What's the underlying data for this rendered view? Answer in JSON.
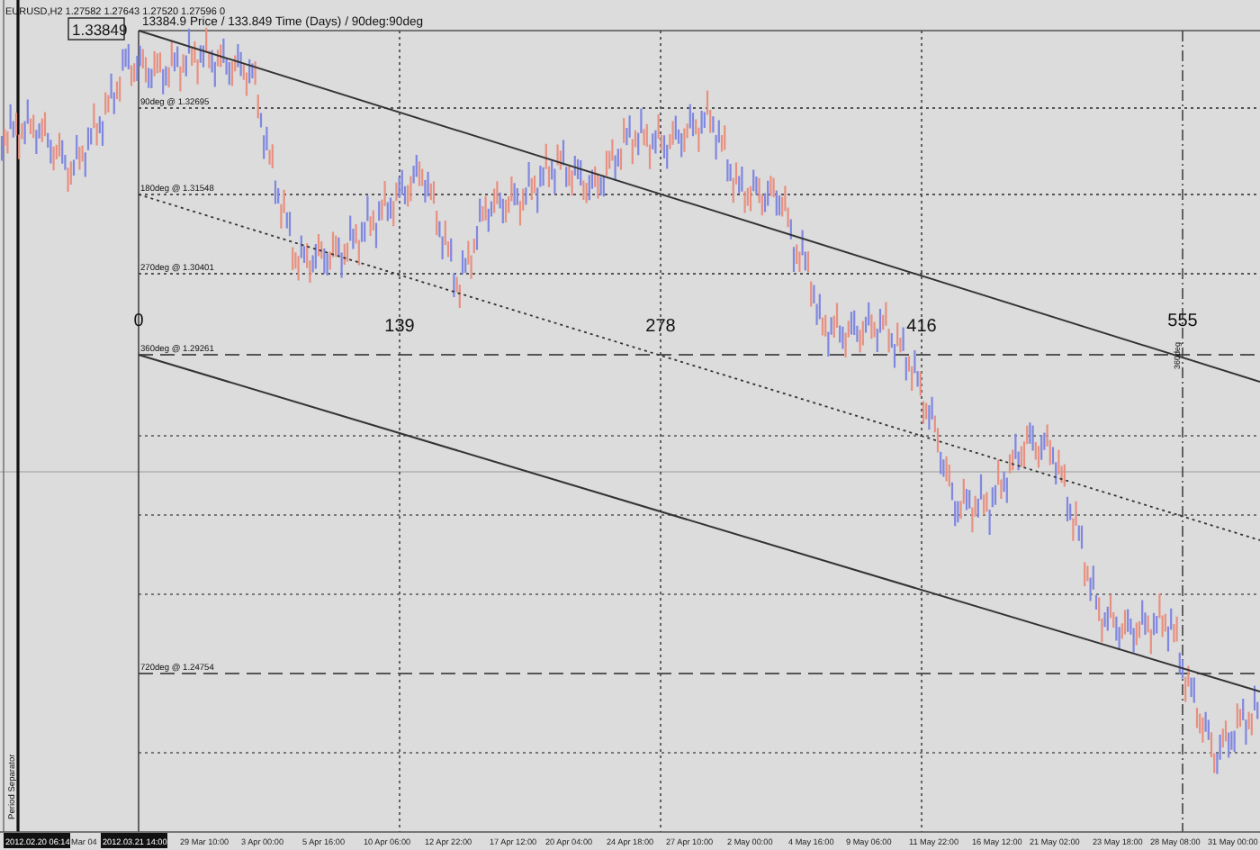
{
  "symbol_bar": "EURUSD,H2  1.27582 1.27643 1.27520 1.27596  0",
  "price_label": "1.33849",
  "gann_title": "13384.9 Price / 133.849 Time (Days) / 90deg:90deg",
  "levels": [
    {
      "label": "90deg @ 1.32695",
      "kind": "dotted"
    },
    {
      "label": "180deg @ 1.31548",
      "kind": "dotted"
    },
    {
      "label": "270deg @ 1.30401",
      "kind": "dotted"
    },
    {
      "label": "360deg @ 1.29261",
      "kind": "dashed"
    },
    {
      "label": "720deg @ 1.24754",
      "kind": "dashed"
    }
  ],
  "time_markers": [
    "0",
    "139",
    "278",
    "416",
    "555"
  ],
  "vertical_label": "360deg",
  "separator_label": "Period Separator",
  "time_axis": [
    {
      "label": "2012.02.20 06:14",
      "highlighted": true
    },
    {
      "label": "Mar 04",
      "highlighted": false
    },
    {
      "label": "2012.03.21 14:00",
      "highlighted": true
    },
    {
      "label": "29 Mar 10:00",
      "highlighted": false
    },
    {
      "label": "3 Apr 00:00",
      "highlighted": false
    },
    {
      "label": "5 Apr 16:00",
      "highlighted": false
    },
    {
      "label": "10 Apr 06:00",
      "highlighted": false
    },
    {
      "label": "12 Apr 22:00",
      "highlighted": false
    },
    {
      "label": "17 Apr 12:00",
      "highlighted": false
    },
    {
      "label": "20 Apr 04:00",
      "highlighted": false
    },
    {
      "label": "24 Apr 18:00",
      "highlighted": false
    },
    {
      "label": "27 Apr 10:00",
      "highlighted": false
    },
    {
      "label": "2 May 00:00",
      "highlighted": false
    },
    {
      "label": "4 May 16:00",
      "highlighted": false
    },
    {
      "label": "9 May 06:00",
      "highlighted": false
    },
    {
      "label": "11 May 22:00",
      "highlighted": false
    },
    {
      "label": "16 May 12:00",
      "highlighted": false
    },
    {
      "label": "21 May 02:00",
      "highlighted": false
    },
    {
      "label": "23 May 18:00",
      "highlighted": false
    },
    {
      "label": "28 May 08:00",
      "highlighted": false
    },
    {
      "label": "31 May 00:00",
      "highlighted": false
    }
  ]
}
